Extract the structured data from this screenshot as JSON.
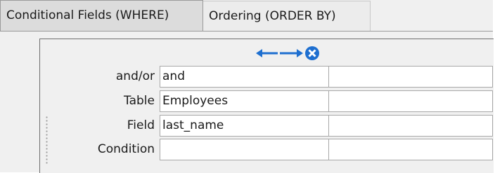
{
  "tabs": [
    {
      "label": "Conditional Fields (WHERE)",
      "active": true
    },
    {
      "label": "Ordering (ORDER BY)",
      "active": false
    }
  ],
  "toolbar": {
    "icons": [
      "arrow-left-icon",
      "arrow-right-icon",
      "remove-circle-icon"
    ],
    "accent_color": "#1e6fd0"
  },
  "grid": {
    "rows": [
      {
        "label": "and/or",
        "value": "and",
        "value2": ""
      },
      {
        "label": "Table",
        "value": "Employees",
        "value2": ""
      },
      {
        "label": "Field",
        "value": "last_name",
        "value2": ""
      },
      {
        "label": "Condition",
        "value": "",
        "value2": ""
      }
    ]
  }
}
